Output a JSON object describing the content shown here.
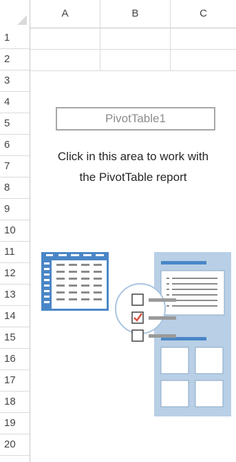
{
  "columns": [
    "A",
    "B",
    "C"
  ],
  "rows": [
    "1",
    "2",
    "3",
    "4",
    "5",
    "6",
    "7",
    "8",
    "9",
    "10",
    "11",
    "12",
    "13",
    "14",
    "15",
    "16",
    "17",
    "18",
    "19",
    "20"
  ],
  "pivot": {
    "name": "PivotTable1",
    "help_line1": "Click in this area to work with",
    "help_line2": "the PivotTable report"
  },
  "colors": {
    "illustration_blue": "#4a86c7",
    "panel_blue": "#b8cfe6",
    "check_red": "#d9503f"
  }
}
